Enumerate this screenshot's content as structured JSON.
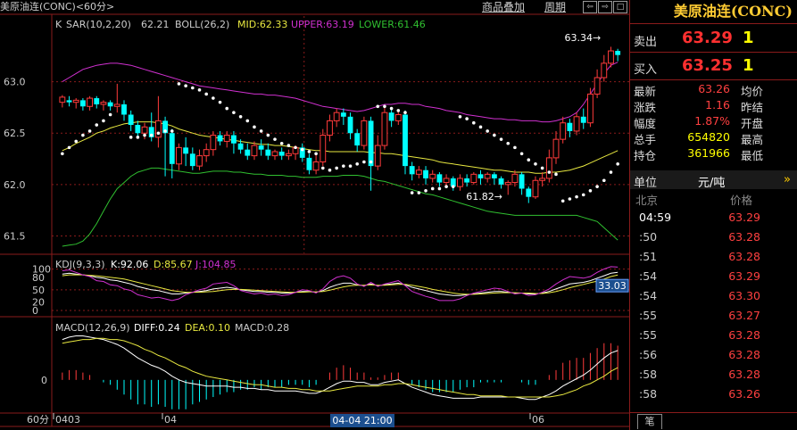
{
  "title": "美原油连(CONC)<60分>",
  "toolbar": {
    "btn1": "商品叠加",
    "btn2": "周期",
    "nav": [
      "⇦",
      "⇨",
      "□",
      "▣"
    ]
  },
  "legend": {
    "k": "K",
    "sar": "SAR(10,2,20)",
    "sar_val": "62.21",
    "boll": "BOLL(26,2)",
    "mid": "MID:62.33",
    "upper": "UPPER:63.19",
    "lower": "LOWER:61.46",
    "kdj": "KDJ(9,3,3)",
    "kdj_k": "K:92.06",
    "kdj_d": "D:85.67",
    "kdj_j": "J:104.85",
    "macd": "MACD(12,26,9)",
    "diff": "DIFF:0.24",
    "dea": "DEA:0.10",
    "macd_val": "MACD:0.28"
  },
  "annotations": {
    "high": "63.34",
    "low": "61.82",
    "kdj_tag": "33.03"
  },
  "xaxis": {
    "period": "60分",
    "labels": [
      "0403",
      "04",
      "06"
    ],
    "cursor": "04-04 21:00"
  },
  "chart_data": {
    "type": "candlestick",
    "price_ylim": [
      61.4,
      63.5
    ],
    "price_ticks": [
      "63.0",
      "62.5",
      "62.0",
      "61.5"
    ],
    "kdj_ticks": [
      "100",
      "80",
      "50",
      "20",
      "0"
    ],
    "macd_ticks": [
      "0"
    ],
    "candles": [
      [
        62.8,
        62.85,
        62.75,
        62.87
      ],
      [
        62.82,
        62.8,
        62.76,
        62.86
      ],
      [
        62.8,
        62.82,
        62.74,
        62.84
      ],
      [
        62.82,
        62.76,
        62.72,
        62.84
      ],
      [
        62.76,
        62.84,
        62.72,
        62.86
      ],
      [
        62.84,
        62.78,
        62.74,
        62.86
      ],
      [
        62.78,
        62.8,
        62.72,
        62.82
      ],
      [
        62.8,
        62.76,
        62.72,
        62.82
      ],
      [
        62.76,
        62.78,
        62.7,
        62.98
      ],
      [
        62.78,
        62.68,
        62.62,
        62.82
      ],
      [
        62.68,
        62.58,
        62.52,
        62.72
      ],
      [
        62.58,
        62.5,
        62.46,
        62.62
      ],
      [
        62.5,
        62.56,
        62.44,
        62.6
      ],
      [
        62.56,
        62.46,
        62.42,
        62.7
      ],
      [
        62.46,
        62.62,
        62.36,
        62.86
      ],
      [
        62.62,
        62.5,
        62.08,
        62.66
      ],
      [
        62.5,
        62.2,
        62.06,
        62.54
      ],
      [
        62.2,
        62.36,
        62.14,
        62.4
      ],
      [
        62.36,
        62.3,
        62.18,
        62.46
      ],
      [
        62.3,
        62.18,
        62.14,
        62.36
      ],
      [
        62.18,
        62.28,
        62.14,
        62.34
      ],
      [
        62.28,
        62.34,
        62.22,
        62.4
      ],
      [
        62.34,
        62.48,
        62.28,
        62.52
      ],
      [
        62.48,
        62.42,
        62.38,
        62.52
      ],
      [
        62.42,
        62.48,
        62.36,
        62.52
      ],
      [
        62.48,
        62.4,
        62.3,
        62.52
      ],
      [
        62.4,
        62.34,
        62.3,
        62.44
      ],
      [
        62.34,
        62.28,
        62.24,
        62.4
      ],
      [
        62.28,
        62.38,
        62.24,
        62.42
      ],
      [
        62.38,
        62.34,
        62.28,
        62.44
      ],
      [
        62.34,
        62.28,
        62.24,
        62.4
      ],
      [
        62.28,
        62.32,
        62.24,
        62.34
      ],
      [
        62.32,
        62.28,
        62.24,
        62.36
      ],
      [
        62.28,
        62.3,
        62.24,
        62.34
      ],
      [
        62.3,
        62.36,
        62.24,
        62.38
      ],
      [
        62.36,
        62.26,
        62.22,
        62.4
      ],
      [
        62.26,
        62.14,
        62.1,
        62.3
      ],
      [
        62.14,
        62.22,
        62.1,
        62.3
      ],
      [
        62.22,
        62.48,
        62.18,
        62.54
      ],
      [
        62.48,
        62.62,
        62.42,
        62.68
      ],
      [
        62.62,
        62.7,
        62.56,
        62.74
      ],
      [
        62.7,
        62.66,
        62.58,
        62.74
      ],
      [
        62.66,
        62.5,
        62.44,
        62.7
      ],
      [
        62.5,
        62.38,
        62.32,
        62.54
      ],
      [
        62.38,
        62.62,
        62.34,
        62.66
      ],
      [
        62.62,
        62.18,
        61.94,
        62.66
      ],
      [
        62.18,
        62.38,
        62.14,
        62.48
      ],
      [
        62.38,
        62.7,
        62.34,
        62.76
      ],
      [
        62.7,
        62.62,
        62.56,
        62.74
      ],
      [
        62.62,
        62.68,
        62.58,
        62.72
      ],
      [
        62.68,
        62.18,
        62.1,
        62.72
      ],
      [
        62.18,
        62.1,
        62.04,
        62.22
      ],
      [
        62.1,
        62.14,
        62.06,
        62.18
      ],
      [
        62.14,
        62.06,
        62.0,
        62.18
      ],
      [
        62.06,
        62.1,
        62.02,
        62.14
      ],
      [
        62.1,
        62.02,
        61.98,
        62.12
      ],
      [
        62.02,
        62.06,
        61.98,
        62.1
      ],
      [
        62.06,
        61.98,
        61.94,
        62.08
      ],
      [
        61.98,
        62.06,
        61.94,
        62.1
      ],
      [
        62.06,
        62.02,
        61.98,
        62.1
      ],
      [
        62.02,
        62.1,
        62.0,
        62.12
      ],
      [
        62.1,
        62.06,
        62.0,
        62.14
      ],
      [
        62.06,
        62.1,
        62.02,
        62.12
      ],
      [
        62.1,
        62.06,
        62.0,
        62.12
      ],
      [
        62.06,
        62.0,
        61.96,
        62.08
      ],
      [
        62.0,
        62.02,
        61.9,
        62.04
      ],
      [
        62.02,
        62.1,
        61.98,
        62.14
      ],
      [
        62.1,
        61.96,
        61.9,
        62.12
      ],
      [
        61.96,
        61.88,
        61.82,
        61.98
      ],
      [
        61.88,
        62.04,
        61.86,
        62.08
      ],
      [
        62.04,
        62.06,
        61.98,
        62.12
      ],
      [
        62.06,
        62.26,
        62.02,
        62.34
      ],
      [
        62.26,
        62.44,
        62.2,
        62.52
      ],
      [
        62.44,
        62.6,
        62.4,
        62.66
      ],
      [
        62.6,
        62.52,
        62.46,
        62.64
      ],
      [
        62.52,
        62.66,
        62.48,
        62.7
      ],
      [
        62.66,
        62.6,
        62.54,
        62.74
      ],
      [
        62.6,
        62.88,
        62.56,
        62.94
      ],
      [
        62.88,
        63.04,
        62.84,
        63.12
      ],
      [
        63.04,
        63.18,
        63.0,
        63.26
      ],
      [
        63.18,
        63.3,
        63.14,
        63.34
      ],
      [
        63.3,
        63.26,
        63.2,
        63.32
      ]
    ],
    "sar": [
      62.3,
      62.36,
      62.42,
      62.48,
      62.52,
      62.58,
      62.62,
      62.68,
      null,
      null,
      62.46,
      62.46,
      62.48,
      62.48,
      62.5,
      62.52,
      62.52,
      62.98,
      62.96,
      62.94,
      62.92,
      62.88,
      62.84,
      62.8,
      62.74,
      62.7,
      62.66,
      62.62,
      62.56,
      62.52,
      62.48,
      62.44,
      62.4,
      62.38,
      62.36,
      62.34,
      62.32,
      62.3,
      62.16,
      62.14,
      62.16,
      62.18,
      62.18,
      62.2,
      62.22,
      62.22,
      62.76,
      62.76,
      62.74,
      62.72,
      62.7,
      61.92,
      61.92,
      61.94,
      61.96,
      61.96,
      61.98,
      61.98,
      62.66,
      62.64,
      62.6,
      62.56,
      62.52,
      62.48,
      62.44,
      62.4,
      62.36,
      62.3,
      62.24,
      62.2,
      62.16,
      62.12,
      62.1,
      61.84,
      61.86,
      61.88,
      61.9,
      61.94,
      61.98,
      62.04,
      62.12,
      62.2
    ],
    "boll_upper": [
      63.0,
      63.04,
      63.08,
      63.12,
      63.14,
      63.16,
      63.17,
      63.18,
      63.18,
      63.17,
      63.16,
      63.14,
      63.12,
      63.1,
      63.08,
      63.06,
      63.04,
      63.02,
      63.0,
      62.98,
      62.96,
      62.95,
      62.94,
      62.93,
      62.92,
      62.91,
      62.9,
      62.89,
      62.88,
      62.88,
      62.87,
      62.87,
      62.86,
      62.85,
      62.84,
      62.82,
      62.8,
      62.78,
      62.76,
      62.75,
      62.74,
      62.73,
      62.72,
      62.71,
      62.72,
      62.74,
      62.76,
      62.78,
      62.78,
      62.79,
      62.79,
      62.78,
      62.78,
      62.76,
      62.75,
      62.74,
      62.72,
      62.71,
      62.7,
      62.68,
      62.67,
      62.66,
      62.65,
      62.64,
      62.64,
      62.63,
      62.63,
      62.62,
      62.62,
      62.62,
      62.61,
      62.61,
      62.62,
      62.64,
      62.66,
      62.7,
      62.78,
      62.88,
      62.98,
      63.08,
      63.16,
      63.19
    ],
    "boll_mid": [
      62.33,
      62.36,
      62.4,
      62.43,
      62.46,
      62.5,
      62.52,
      62.55,
      62.57,
      62.59,
      62.6,
      62.61,
      62.61,
      62.61,
      62.6,
      62.59,
      62.57,
      62.54,
      62.52,
      62.5,
      62.48,
      62.47,
      62.46,
      62.45,
      62.44,
      62.43,
      62.42,
      62.41,
      62.4,
      62.39,
      62.39,
      62.38,
      62.38,
      62.37,
      62.36,
      62.35,
      62.34,
      62.33,
      62.33,
      62.32,
      62.32,
      62.32,
      62.32,
      62.32,
      62.32,
      62.31,
      62.31,
      62.3,
      62.3,
      62.29,
      62.28,
      62.27,
      62.26,
      62.25,
      62.24,
      62.22,
      62.21,
      62.2,
      62.19,
      62.18,
      62.17,
      62.16,
      62.15,
      62.14,
      62.14,
      62.13,
      62.12,
      62.12,
      62.12,
      62.11,
      62.11,
      62.12,
      62.12,
      62.13,
      62.14,
      62.16,
      62.18,
      62.21,
      62.24,
      62.27,
      62.3,
      62.33
    ],
    "boll_lower": [
      61.4,
      61.41,
      61.42,
      61.45,
      61.52,
      61.62,
      61.74,
      61.86,
      61.96,
      62.02,
      62.08,
      62.12,
      62.14,
      62.16,
      62.16,
      62.15,
      62.14,
      62.13,
      62.12,
      62.11,
      62.11,
      62.12,
      62.13,
      62.13,
      62.13,
      62.12,
      62.12,
      62.11,
      62.1,
      62.1,
      62.09,
      62.09,
      62.09,
      62.08,
      62.08,
      62.07,
      62.07,
      62.07,
      62.08,
      62.08,
      62.08,
      62.09,
      62.09,
      62.09,
      62.08,
      62.06,
      62.04,
      62.03,
      62.01,
      61.99,
      61.97,
      61.95,
      61.93,
      61.91,
      61.9,
      61.88,
      61.86,
      61.84,
      61.82,
      61.8,
      61.78,
      61.76,
      61.74,
      61.73,
      61.72,
      61.71,
      61.7,
      61.7,
      61.7,
      61.7,
      61.7,
      61.7,
      61.7,
      61.7,
      61.7,
      61.7,
      61.68,
      61.66,
      61.64,
      61.58,
      61.52,
      61.46
    ],
    "kdj_k": [
      88,
      90,
      88,
      86,
      84,
      80,
      78,
      74,
      72,
      68,
      64,
      58,
      54,
      50,
      48,
      44,
      40,
      40,
      42,
      44,
      46,
      48,
      52,
      54,
      56,
      54,
      50,
      48,
      46,
      46,
      44,
      44,
      42,
      42,
      44,
      46,
      46,
      44,
      48,
      56,
      62,
      66,
      66,
      62,
      60,
      64,
      60,
      62,
      64,
      66,
      62,
      56,
      52,
      48,
      44,
      40,
      38,
      36,
      36,
      38,
      40,
      42,
      44,
      46,
      46,
      44,
      42,
      42,
      40,
      40,
      42,
      46,
      52,
      58,
      64,
      66,
      68,
      72,
      78,
      84,
      90,
      92.06
    ],
    "kdj_d": [
      84,
      86,
      86,
      86,
      85,
      84,
      82,
      80,
      78,
      76,
      72,
      68,
      64,
      60,
      56,
      52,
      48,
      46,
      44,
      44,
      44,
      45,
      46,
      48,
      50,
      51,
      51,
      50,
      49,
      48,
      47,
      46,
      45,
      44,
      44,
      44,
      45,
      45,
      46,
      49,
      53,
      57,
      60,
      61,
      61,
      62,
      61,
      61,
      62,
      63,
      63,
      61,
      58,
      55,
      51,
      48,
      45,
      42,
      40,
      39,
      39,
      40,
      41,
      42,
      43,
      43,
      43,
      42,
      42,
      41,
      41,
      43,
      46,
      50,
      55,
      59,
      63,
      67,
      71,
      76,
      82,
      85.67
    ],
    "kdj_j": [
      96,
      98,
      92,
      86,
      82,
      72,
      70,
      62,
      60,
      52,
      48,
      38,
      34,
      30,
      32,
      28,
      24,
      28,
      38,
      44,
      50,
      54,
      64,
      66,
      68,
      60,
      48,
      44,
      40,
      42,
      38,
      40,
      36,
      38,
      44,
      50,
      48,
      42,
      52,
      70,
      80,
      84,
      78,
      64,
      58,
      68,
      58,
      64,
      68,
      72,
      60,
      46,
      40,
      34,
      30,
      24,
      24,
      24,
      28,
      36,
      42,
      46,
      50,
      54,
      52,
      46,
      40,
      42,
      36,
      38,
      44,
      52,
      64,
      74,
      82,
      80,
      78,
      82,
      92,
      100,
      106,
      104.85
    ],
    "macd_diff": [
      0.33,
      0.35,
      0.36,
      0.36,
      0.35,
      0.34,
      0.33,
      0.31,
      0.29,
      0.26,
      0.22,
      0.18,
      0.15,
      0.12,
      0.1,
      0.07,
      0.03,
      0.0,
      -0.02,
      -0.03,
      -0.04,
      -0.05,
      -0.05,
      -0.05,
      -0.05,
      -0.06,
      -0.06,
      -0.07,
      -0.07,
      -0.08,
      -0.08,
      -0.09,
      -0.09,
      -0.09,
      -0.09,
      -0.1,
      -0.11,
      -0.11,
      -0.09,
      -0.06,
      -0.03,
      -0.01,
      -0.01,
      -0.02,
      -0.02,
      -0.04,
      -0.04,
      -0.02,
      -0.01,
      0.0,
      -0.03,
      -0.06,
      -0.08,
      -0.1,
      -0.12,
      -0.13,
      -0.14,
      -0.15,
      -0.15,
      -0.15,
      -0.15,
      -0.14,
      -0.14,
      -0.14,
      -0.14,
      -0.14,
      -0.14,
      -0.15,
      -0.16,
      -0.16,
      -0.14,
      -0.12,
      -0.09,
      -0.05,
      -0.02,
      0.01,
      0.04,
      0.08,
      0.13,
      0.18,
      0.22,
      0.24
    ],
    "macd_dea": [
      0.3,
      0.31,
      0.32,
      0.33,
      0.33,
      0.34,
      0.34,
      0.33,
      0.33,
      0.32,
      0.3,
      0.28,
      0.25,
      0.23,
      0.2,
      0.18,
      0.15,
      0.12,
      0.1,
      0.07,
      0.05,
      0.03,
      0.02,
      0.01,
      0.0,
      -0.01,
      -0.02,
      -0.03,
      -0.04,
      -0.04,
      -0.05,
      -0.06,
      -0.06,
      -0.07,
      -0.07,
      -0.08,
      -0.08,
      -0.09,
      -0.09,
      -0.09,
      -0.08,
      -0.07,
      -0.06,
      -0.05,
      -0.05,
      -0.05,
      -0.05,
      -0.04,
      -0.04,
      -0.03,
      -0.03,
      -0.04,
      -0.05,
      -0.06,
      -0.07,
      -0.08,
      -0.09,
      -0.1,
      -0.11,
      -0.12,
      -0.12,
      -0.13,
      -0.13,
      -0.13,
      -0.13,
      -0.14,
      -0.14,
      -0.14,
      -0.14,
      -0.14,
      -0.14,
      -0.14,
      -0.13,
      -0.12,
      -0.1,
      -0.08,
      -0.05,
      -0.03,
      0.0,
      0.03,
      0.07,
      0.1
    ]
  },
  "sidebar": {
    "title": "美原油连(CONC)",
    "sell_label": "卖出",
    "sell_price": "63.29",
    "sell_qty": "1",
    "buy_label": "买入",
    "buy_price": "63.25",
    "buy_qty": "1",
    "quotes": [
      {
        "k": "最新",
        "v": "63.26",
        "c": "#ff4040",
        "k2": "均价"
      },
      {
        "k": "涨跌",
        "v": "1.16",
        "c": "#ff4040",
        "k2": "昨结"
      },
      {
        "k": "幅度",
        "v": "1.87%",
        "c": "#ff4040",
        "k2": "开盘"
      },
      {
        "k": "总手",
        "v": "654820",
        "c": "#ffff00",
        "k2": "最高"
      },
      {
        "k": "持仓",
        "v": "361966",
        "c": "#ffff00",
        "k2": "最低"
      }
    ],
    "unit_label": "单位",
    "unit_value": "元/吨",
    "unit_arrow": "»",
    "tick_header_left": "北京",
    "tick_header_right": "价格",
    "ticks": [
      {
        "t": "04:59",
        "p": "63.29"
      },
      {
        "t": ":50",
        "p": "63.28"
      },
      {
        "t": ":51",
        "p": "63.28"
      },
      {
        "t": ":54",
        "p": "63.29"
      },
      {
        "t": ":54",
        "p": "63.30"
      },
      {
        "t": ":55",
        "p": "63.27"
      },
      {
        "t": ":55",
        "p": "63.28"
      },
      {
        "t": ":56",
        "p": "63.28"
      },
      {
        "t": ":58",
        "p": "63.28"
      },
      {
        "t": ":58",
        "p": "63.26"
      }
    ],
    "bottom_tab": "笔"
  },
  "colors": {
    "up": "#ff3b3b",
    "down": "#00ffff",
    "upper": "#d030d0",
    "mid": "#e8e840",
    "lower": "#30c030",
    "grid": "#8a1b1b"
  }
}
